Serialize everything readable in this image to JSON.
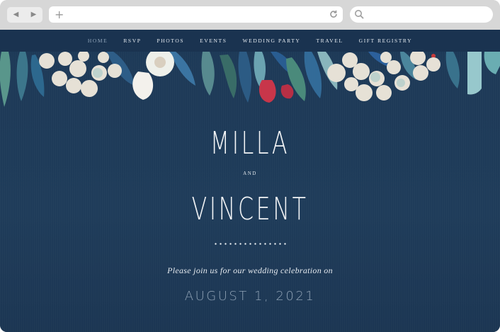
{
  "browser": {
    "back_icon": "back-arrow-icon",
    "forward_icon": "forward-arrow-icon",
    "new_tab_icon": "plus-icon",
    "reload_icon": "reload-icon",
    "search_icon": "search-icon"
  },
  "nav": {
    "items": [
      "HOME",
      "RSVP",
      "PHOTOS",
      "EVENTS",
      "WEDDING PARTY",
      "TRAVEL",
      "GIFT REGISTRY"
    ],
    "active": "HOME"
  },
  "hero": {
    "name1": "MILLA",
    "and": "AND",
    "name2": "VINCENT",
    "invite": "Please join us for our wedding celebration on",
    "date": "AUGUST 1, 2021"
  },
  "colors": {
    "background": "#1e3a57",
    "nav_active": "#8fa3b8",
    "date_text": "#8fa2b5"
  }
}
